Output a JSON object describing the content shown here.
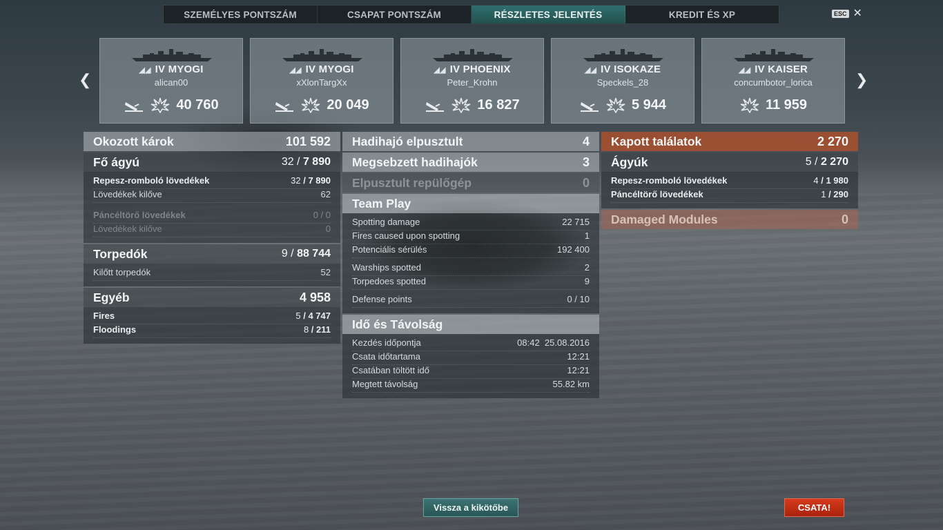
{
  "tabs": [
    {
      "label": "SZEMÉLYES PONTSZÁM"
    },
    {
      "label": "CSAPAT PONTSZÁM"
    },
    {
      "label": "RÉSZLETES JELENTÉS"
    },
    {
      "label": "KREDIT ÉS XP"
    }
  ],
  "esc": {
    "key": "ESC",
    "close": "✕"
  },
  "nav": {
    "prev": "❮",
    "next": "❯"
  },
  "ships": [
    {
      "tier": "IV",
      "name": "MYOGI",
      "player": "alican00",
      "score": "40 760"
    },
    {
      "tier": "IV",
      "name": "MYOGI",
      "player": "xXlonTargXx",
      "score": "20 049"
    },
    {
      "tier": "IV",
      "name": "PHOENIX",
      "player": "Peter_Krohn",
      "score": "16 827"
    },
    {
      "tier": "IV",
      "name": "ISOKAZE",
      "player": "Speckels_28",
      "score": "5 944"
    },
    {
      "tier": "IV",
      "name": "KAISER",
      "player": "concumbotor_lorica",
      "score": "11 959"
    }
  ],
  "damage": {
    "title": "Okozott károk",
    "total": "101 592",
    "main_guns": {
      "label": "Fő ágyú",
      "hits": "32",
      "value": "7 890"
    },
    "he": {
      "label": "Repesz-romboló lövedékek",
      "hits": "32",
      "value": "7 890",
      "fired_label": "Lövedékek kilőve",
      "fired": "62"
    },
    "ap": {
      "label": "Páncéltörő lövedékek",
      "hits": "0",
      "value": "0",
      "fired_label": "Lövedékek kilőve",
      "fired": "0"
    },
    "torpedoes": {
      "label": "Torpedók",
      "hits": "9",
      "value": "88 744",
      "fired_label": "Kilőtt torpedók",
      "fired": "52"
    },
    "other": {
      "label": "Egyéb",
      "value": "4 958",
      "fires": {
        "label": "Fires",
        "count": "5",
        "value": "4 747"
      },
      "floodings": {
        "label": "Floodings",
        "count": "8",
        "value": "211"
      }
    }
  },
  "kills": {
    "destroyed": {
      "label": "Hadihajó elpusztult",
      "value": "4"
    },
    "damaged": {
      "label": "Megsebzett hadihajók",
      "value": "3"
    },
    "planes": {
      "label": "Elpusztult repülőgép",
      "value": "0"
    }
  },
  "team_play": {
    "title": "Team Play",
    "rows": [
      {
        "label": "Spotting damage",
        "value": "22 715"
      },
      {
        "label": "Fires caused upon spotting",
        "value": "1"
      },
      {
        "label": "Potenciális sérülés",
        "value": "192 400"
      },
      {
        "label": "Warships spotted",
        "value": "2"
      },
      {
        "label": "Torpedoes spotted",
        "value": "9"
      },
      {
        "label": "Defense points",
        "value": "0 / 10"
      }
    ]
  },
  "time": {
    "title": "Idő és Távolság",
    "rows": [
      {
        "label": "Kezdés időpontja",
        "value": "08:42  25.08.2016"
      },
      {
        "label": "Csata időtartama",
        "value": "12:21"
      },
      {
        "label": "Csatában töltött idő",
        "value": "12:21"
      },
      {
        "label": "Megtett távolság",
        "value": "55.82 km"
      }
    ]
  },
  "received": {
    "title": "Kapott találatok",
    "total": "2 270",
    "guns": {
      "label": "Ágyúk",
      "hits": "5",
      "value": "2 270"
    },
    "he": {
      "label": "Repesz-romboló lövedékek",
      "hits": "4",
      "value": "1 980"
    },
    "ap": {
      "label": "Páncéltörő lövedékek",
      "hits": "1",
      "value": "290"
    },
    "modules": {
      "label": "Damaged Modules",
      "value": "0"
    }
  },
  "buttons": {
    "port": "Vissza a kikötőbe",
    "battle": "CSATA!"
  },
  "colors": {
    "active_tab": "#2f6e6e",
    "received_header": "#aa502d",
    "battle_button": "#c92f16",
    "port_button": "#336565"
  }
}
